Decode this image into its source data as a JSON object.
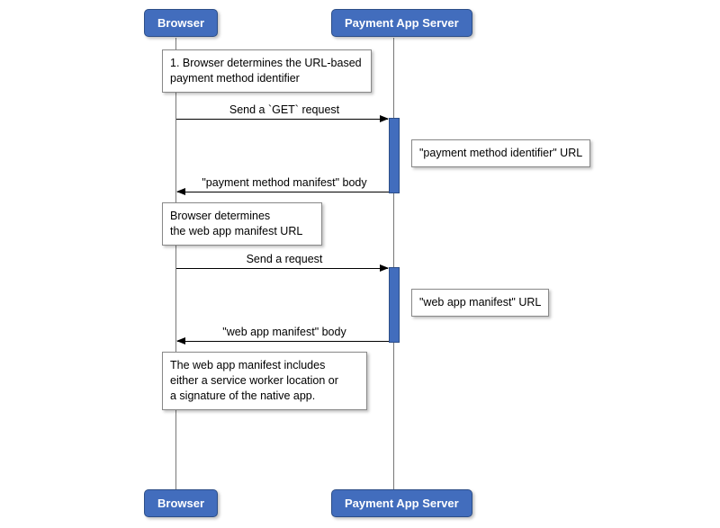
{
  "participants": {
    "browser": "Browser",
    "server": "Payment App Server"
  },
  "notes": {
    "n1": "1. Browser determines the URL-based\npayment method identifier",
    "n2": "\"payment method identifier\" URL",
    "n3": "Browser determines\nthe web app manifest URL",
    "n4": "\"web app manifest\" URL",
    "n5": "The web app manifest includes\neither a service worker location or\na signature of the native app."
  },
  "messages": {
    "m1": "Send a `GET` request",
    "m2": "\"payment method manifest\" body",
    "m3": "Send a request",
    "m4": "\"web app manifest\" body"
  }
}
